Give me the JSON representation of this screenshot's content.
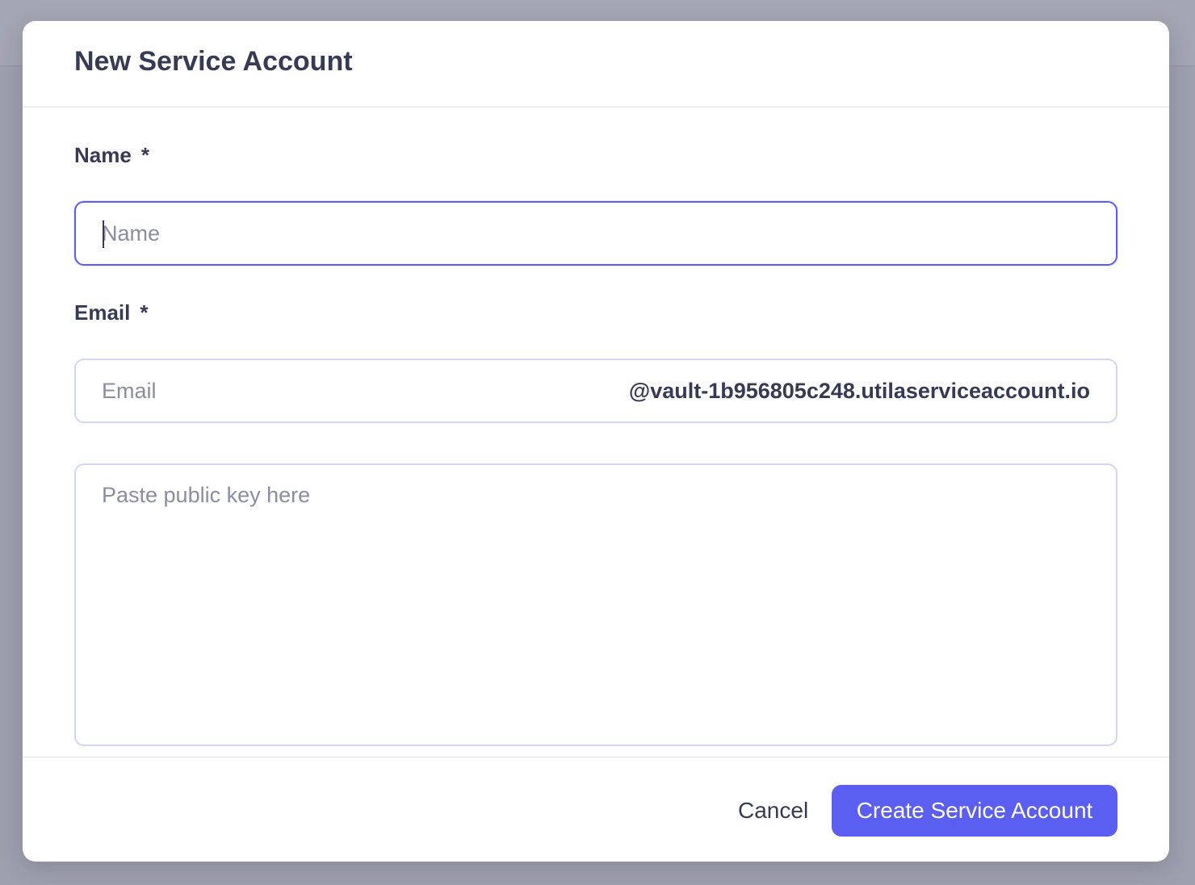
{
  "dialog": {
    "title": "New Service Account"
  },
  "form": {
    "name": {
      "label": "Name",
      "required_mark": "*",
      "value": "",
      "placeholder": "Name"
    },
    "email": {
      "label": "Email",
      "required_mark": "*",
      "value": "",
      "placeholder": "Email",
      "domain_suffix": "@vault-1b956805c248.utilaserviceaccount.io"
    },
    "public_key": {
      "value": "",
      "placeholder": "Paste public key here"
    }
  },
  "footer": {
    "cancel_label": "Cancel",
    "create_label": "Create Service Account"
  },
  "colors": {
    "accent": "#5a5ff2",
    "text": "#373a55",
    "placeholder": "#8b8da0",
    "border": "#d3d6f2",
    "overlay": "#9fa0ae"
  }
}
